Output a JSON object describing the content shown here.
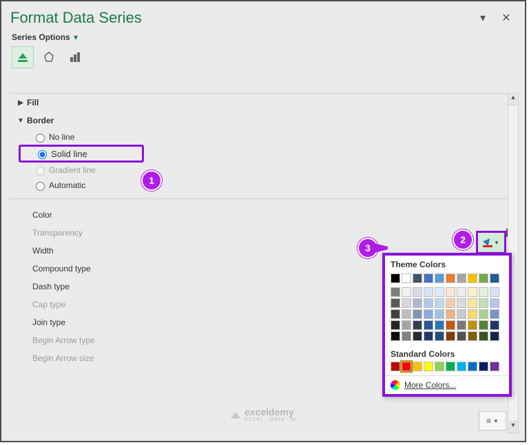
{
  "header": {
    "title": "Format Data Series"
  },
  "series_options_label": "Series Options",
  "sections": {
    "fill": "Fill",
    "border": "Border"
  },
  "border_radios": {
    "no_line": "No line",
    "solid_line": "Solid line",
    "gradient_line": "Gradient line",
    "automatic": "Automatic"
  },
  "border_props": {
    "color": "Color",
    "transparency": "Transparency",
    "width": "Width",
    "compound": "Compound type",
    "dash": "Dash type",
    "cap": "Cap type",
    "join": "Join type",
    "begin_arrow_type": "Begin Arrow type",
    "begin_arrow_size": "Begin Arrow size"
  },
  "steps": {
    "s1": "1",
    "s2": "2",
    "s3": "3"
  },
  "color_popup": {
    "theme_title": "Theme Colors",
    "standard_title": "Standard Colors",
    "more": "More Colors...",
    "theme_row": [
      "#000000",
      "#ffffff",
      "#44546a",
      "#4472c4",
      "#5b9bd5",
      "#ed7d31",
      "#a5a5a5",
      "#ffc000",
      "#70ad47",
      "#255e91"
    ],
    "shade_cols": [
      [
        "#7f7f7f",
        "#595959",
        "#404040",
        "#262626",
        "#0d0d0d"
      ],
      [
        "#f2f2f2",
        "#d9d9d9",
        "#bfbfbf",
        "#a6a6a6",
        "#808080"
      ],
      [
        "#d6dce5",
        "#adb9ca",
        "#8497b0",
        "#333f50",
        "#222a35"
      ],
      [
        "#d9e2f3",
        "#b4c7e7",
        "#8faadc",
        "#2f5597",
        "#203864"
      ],
      [
        "#deebf7",
        "#bdd7ee",
        "#9dc3e6",
        "#2e75b6",
        "#1f4e79"
      ],
      [
        "#fbe5d6",
        "#f8cbad",
        "#f4b183",
        "#c55a11",
        "#843c0c"
      ],
      [
        "#ededed",
        "#dbdbdb",
        "#c9c9c9",
        "#7b7b7b",
        "#525252"
      ],
      [
        "#fff2cc",
        "#ffe699",
        "#ffd966",
        "#bf9000",
        "#806000"
      ],
      [
        "#e2f0d9",
        "#c5e0b4",
        "#a9d18e",
        "#548235",
        "#385723"
      ],
      [
        "#dae3f3",
        "#b4c7e7",
        "#7b93c9",
        "#1f3864",
        "#132644"
      ]
    ],
    "standard": [
      "#c00000",
      "#ff0000",
      "#ffc000",
      "#ffff00",
      "#92d050",
      "#00b050",
      "#00b0f0",
      "#0070c0",
      "#002060",
      "#7030a0"
    ]
  },
  "watermark": {
    "brand": "exceldemy",
    "sub": "EXCEL · DATA · BI"
  }
}
